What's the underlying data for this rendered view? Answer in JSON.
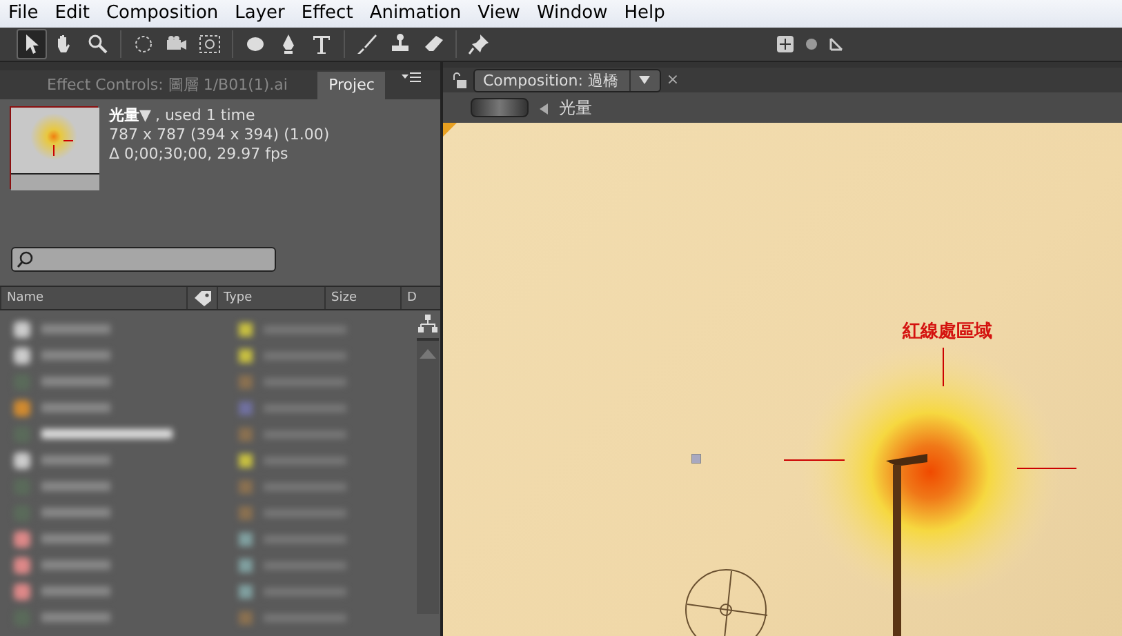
{
  "menu": [
    "File",
    "Edit",
    "Composition",
    "Layer",
    "Effect",
    "Animation",
    "View",
    "Window",
    "Help"
  ],
  "tools": [
    [
      {
        "selected": true
      },
      {
        "selected": false
      },
      {
        "selected": false
      }
    ],
    [
      {
        "selected": false
      },
      {
        "selected": false
      },
      {
        "selected": false
      }
    ],
    [
      {
        "selected": false
      },
      {
        "selected": false
      },
      {
        "selected": false
      }
    ],
    [
      {
        "selected": false
      },
      {
        "selected": false
      },
      {
        "selected": false
      }
    ],
    [
      {
        "selected": false
      }
    ]
  ],
  "left_tabs": [
    {
      "label": "Effect Controls: 圖層 1/B01(1).ai",
      "selected": false
    },
    {
      "label": "Projec",
      "selected": true
    }
  ],
  "project_item": {
    "name": "光量",
    "dropdown": "▼",
    "usage": ", used 1 time",
    "dimensions": "787 x 787  (394 x 394) (1.00)",
    "duration": "Δ 0;00;30;00, 29.97 fps"
  },
  "columns": [
    "Name",
    "Type",
    "Size",
    "D"
  ],
  "composition_tab": {
    "label": "Composition: 過橋",
    "close": "×"
  },
  "composition_name": "光量",
  "annotation": "紅線處區域"
}
